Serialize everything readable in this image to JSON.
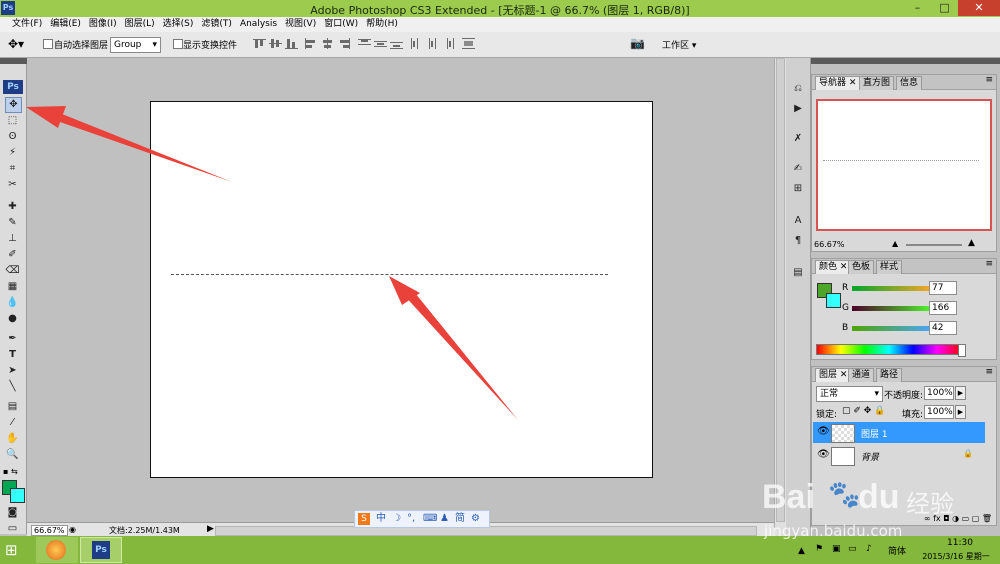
{
  "window": {
    "title": "Adobe Photoshop CS3 Extended - [无标题-1 @ 66.7% (图层 1, RGB/8)]",
    "app_icon": "Ps",
    "minimize": "–",
    "maximize": "□",
    "close": "✕"
  },
  "menu": [
    "文件(F)",
    "编辑(E)",
    "图像(I)",
    "图层(L)",
    "选择(S)",
    "滤镜(T)",
    "Analysis",
    "视图(V)",
    "窗口(W)",
    "帮助(H)"
  ],
  "options": {
    "auto_select_label": "自动选择图层",
    "auto_select_value": "Group",
    "show_transform_label": "显示变换控件",
    "workspace_label": "工作区"
  },
  "toolbox": {
    "ps_logo": "Ps"
  },
  "status": {
    "zoom": "66.67%",
    "doc_info": "文档:2.25M/1.43M"
  },
  "navigator": {
    "tabs": [
      "导航器",
      "直方图",
      "信息"
    ],
    "zoom": "66.67%"
  },
  "color": {
    "tabs": [
      "颜色",
      "色板",
      "样式"
    ],
    "r_label": "R",
    "r": "77",
    "g_label": "G",
    "g": "166",
    "b_label": "B",
    "b": "42",
    "foreground": "#4da62a",
    "background": "#33ffff"
  },
  "layers": {
    "tabs": [
      "图层",
      "通道",
      "路径"
    ],
    "blend_mode": "正常",
    "opacity_label": "不透明度:",
    "opacity": "100%",
    "lock_label": "锁定:",
    "fill_label": "填充:",
    "fill": "100%",
    "items": [
      {
        "name": "图层 1",
        "selected": true
      },
      {
        "name": "背景",
        "selected": false
      }
    ]
  },
  "ime": {
    "lang": "中",
    "simplified": "简"
  },
  "taskbar": {
    "clock_time": "11:30",
    "clock_date": "2015/3/16 星期一",
    "ime_label": "简体"
  },
  "watermark": {
    "brand": "Bai",
    "brand2": "du",
    "cn": "经验",
    "url": "jingyan.baidu.com"
  },
  "colors": {
    "accent_arrow": "#e8423a",
    "titlebar": "#9ccb4e",
    "selection": "#3399ff"
  }
}
